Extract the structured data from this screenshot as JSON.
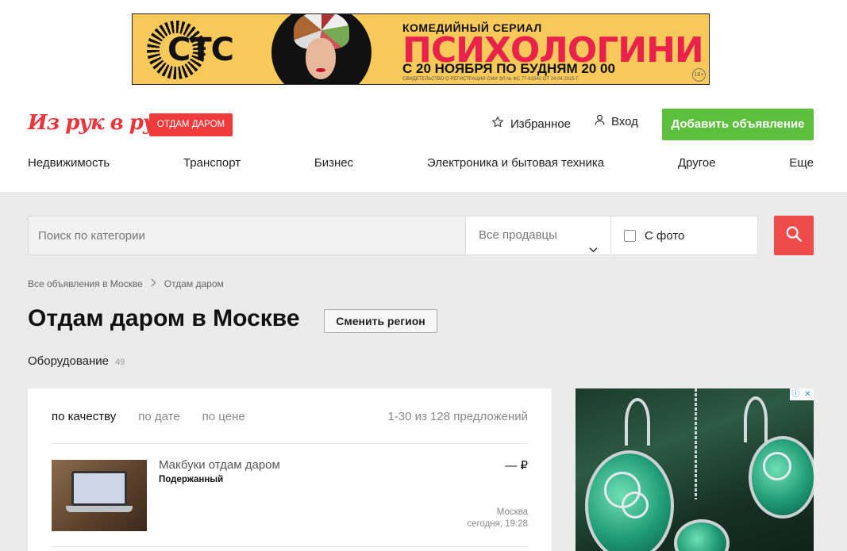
{
  "banner_ad": {
    "brand": "СТС",
    "line1": "КОМЕДИЙНЫЙ СЕРИАЛ",
    "line2": "ПСИХОЛОГИНИ",
    "line3": "С 20 НОЯБРЯ ПО БУДНЯМ 20 00",
    "line4": "СВИДЕТЕЛЬСТВО О РЕГИСТРАЦИИ СМИ ЭЛ № ФС 77-61542 ОТ 24.04.2015 Г.",
    "age": "16+"
  },
  "header": {
    "logo": "Из рук в руки",
    "tag": "ОТДАМ ДАРОМ",
    "favorites": "Избранное",
    "login": "Вход",
    "add_button": "Добавить объявление"
  },
  "nav": [
    "Недвижимость",
    "Транспорт",
    "Бизнес",
    "Электроника и бытовая техника",
    "Другое",
    "Еще"
  ],
  "search": {
    "placeholder": "Поиск по категории",
    "seller_filter": "Все продавцы",
    "photo_filter": "С фото"
  },
  "breadcrumb": [
    "Все объявления в Москве",
    "Отдам даром"
  ],
  "page": {
    "title": "Отдам даром в Москве",
    "region_button": "Сменить регион",
    "subcategory": "Оборудование",
    "subcategory_count": "49"
  },
  "listing": {
    "sort_options": [
      "по качеству",
      "по дате",
      "по цене"
    ],
    "results": "1-30 из 128 предложений",
    "items": [
      {
        "title": "Макбуки отдам даром",
        "condition": "Подержанный",
        "price": "— ₽",
        "city": "Москва",
        "time": "сегодня, 19:28"
      }
    ]
  },
  "colors": {
    "brand_red": "#e8343b",
    "green_button": "#5cbf3e",
    "search_button": "#ef4b4b"
  }
}
